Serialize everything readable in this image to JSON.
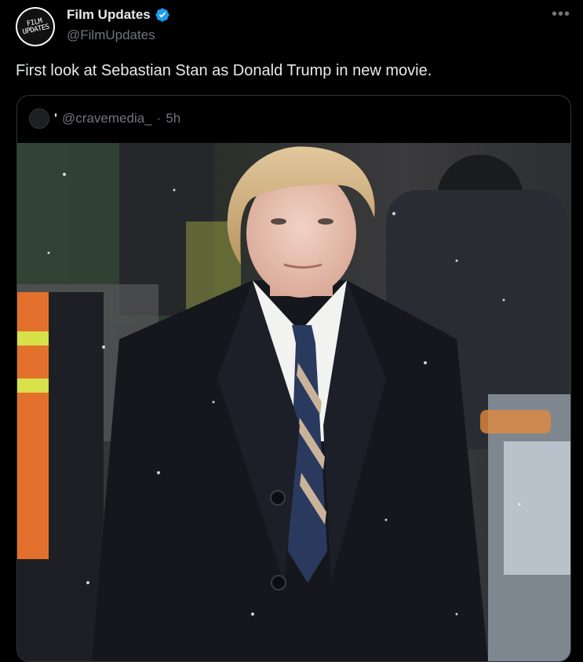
{
  "author": {
    "display_name": "Film Updates",
    "handle": "@FilmUpdates",
    "avatar_text_line1": "FILM",
    "avatar_text_line2": "UPDATES",
    "verified": true
  },
  "more_label": "•••",
  "tweet": {
    "text": "First look at Sebastian Stan as Donald Trump in new movie."
  },
  "quoted": {
    "prefix": "'",
    "handle": "@cravemedia_",
    "separator": "·",
    "time": "5h"
  },
  "colors": {
    "background": "#000000",
    "text_primary": "#e7e9ea",
    "text_secondary": "#71767b",
    "verified": "#1d9bf0",
    "border": "#2f3336"
  },
  "icons": {
    "verified": "verified-badge-icon",
    "more": "more-options-icon"
  }
}
